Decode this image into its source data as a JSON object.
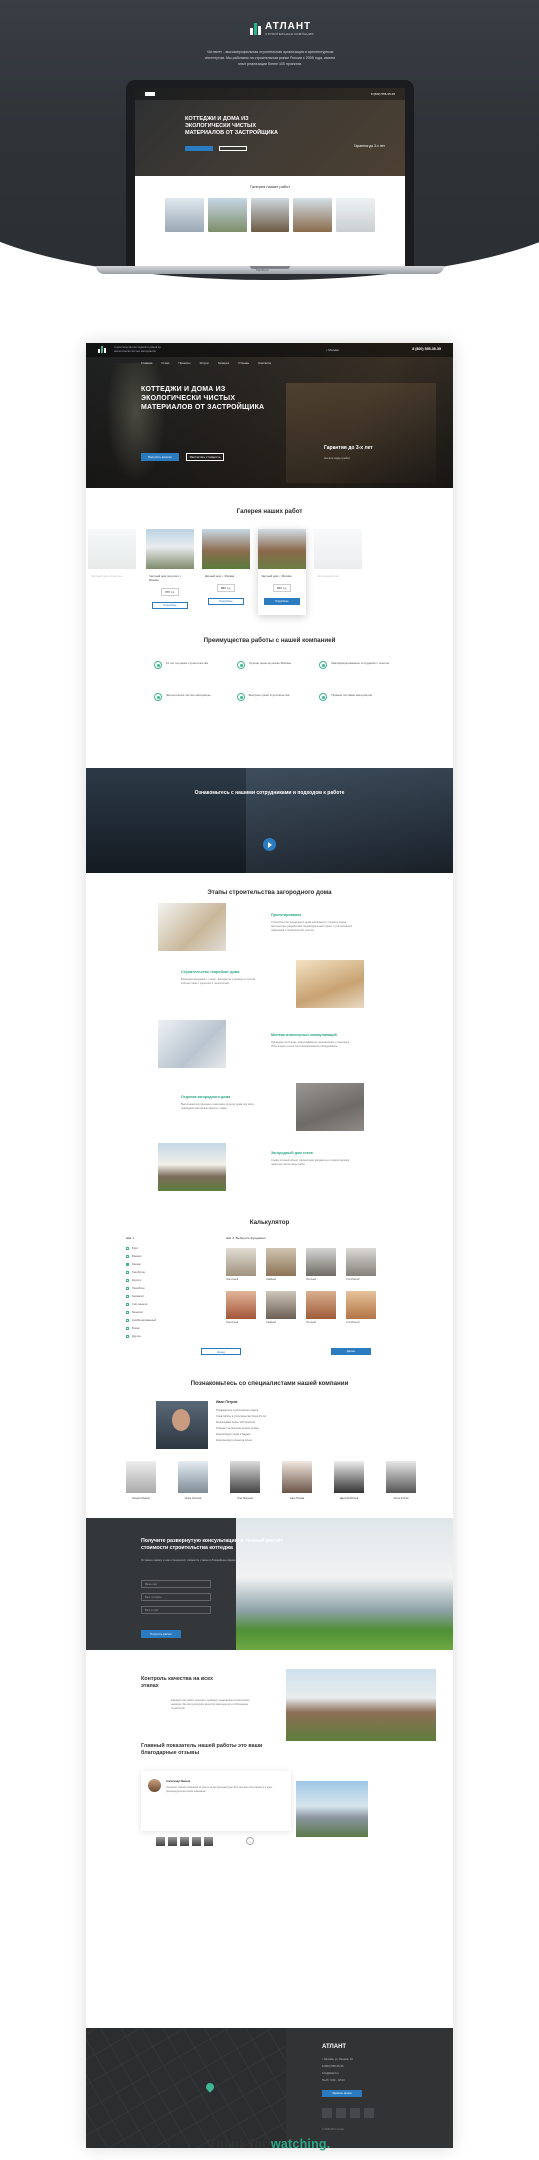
{
  "colors": {
    "accent": "#2aa783",
    "primary_button": "#2a7bc0",
    "dark": "#313335"
  },
  "hero": {
    "brand": "АТЛАНТ",
    "brand_sub": "СТРОИТЕЛЬНАЯ КОМПАНИЯ",
    "intro": "«Атлант» - высокопрофильная строительная организация в архитектурным институтом. Мы работаем на строительном рынке России с 2005 года, имеем опыт реализации более 100 проектов.",
    "laptop_label": "MacBook"
  },
  "laptop_screen": {
    "phone": "8 (800) 555-35-35",
    "title": "КОТТЕДЖИ И ДОМА ИЗ ЭКОЛОГИЧЕСКИ ЧИСТЫХ МАТЕРИАЛОВ ОТ ЗАСТРОЙЩИКА",
    "guarantee": "Гарантия до 3-х лет",
    "gallery_title": "Галерея наших работ"
  },
  "site": {
    "topbar": {
      "tagline": "Строительство коттеджей и домов из экологически чистых материалов",
      "city": "г. Москва",
      "phone": "8 (800) 555-35-35"
    },
    "menu": [
      "Главная",
      "О нас",
      "Проекты",
      "Услуги",
      "Галерея",
      "Отзывы",
      "Контакты"
    ],
    "hero": {
      "title": "КОТТЕДЖИ И ДОМА ИЗ ЭКОЛОГИЧЕСКИ ЧИСТЫХ МАТЕРИАЛОВ ОТ ЗАСТРОЙЩИКА",
      "btn_primary": "Получить каталог",
      "btn_secondary": "Рассчитать стоимость",
      "guarantee": "Гарантия до 3-х лет",
      "guarantee_sub": "На все виды работ"
    },
    "gallery": {
      "title": "Галерея наших работ",
      "cards": [
        {
          "title": "Частный дом «Классик»",
          "price": "",
          "button": ""
        },
        {
          "title": "Частный дом под ключ, г. Москва",
          "price": "765 т.р.",
          "button": "Подробнее"
        },
        {
          "title": "Дачный дом, г. Москва",
          "price": "890 т.р.",
          "button": "Подробнее"
        },
        {
          "title": "Частный дом, г. Москва",
          "price": "820 т.р.",
          "button": "Подробнее"
        },
        {
          "title": "Загородный дом",
          "price": "",
          "button": ""
        }
      ]
    },
    "advantages": {
      "title": "Преимущества работы с нашей компанией",
      "items": [
        "10 лет на рынке строительства",
        "Лучшие цены на рынке Москвы",
        "Квалифицированные сотрудники с опытом",
        "Экологически чистые материалы",
        "Быстрые сроки строительства",
        "Прямые поставки материалов"
      ]
    },
    "video": {
      "title": "Ознакомьтесь с нашими сотрудниками и подходом к работе"
    },
    "stages": {
      "title": "Этапы строительства загородного дома",
      "items": [
        {
          "heading": "Проектирование",
          "text": "Строительство загородного дома начинается с проекта. Наши архитекторы разработают индивидуальный проект с учётом ваших пожеланий и особенностей участка."
        },
        {
          "heading": "Строительство «коробки» дома",
          "text": "Возводим фундамент, стены, перекрытия и кровлю в строгом соответствии с проектом и технологией."
        },
        {
          "heading": "Монтаж инженерных коммуникаций",
          "text": "Проводим отопление, водоснабжение, канализацию и электрику. Используем только сертифицированное оборудование."
        },
        {
          "heading": "Отделка загородного дома",
          "text": "Выполняем внутреннюю и внешнюю отделку дома под ключ, подбираем материалы вместе с вами."
        },
        {
          "heading": "Загородный дом готов",
          "text": "Сдаём готовый объект, оформляем документы и предоставляем гарантию на все виды работ."
        }
      ]
    },
    "calculator": {
      "title": "Калькулятор",
      "step1": "Шаг 1",
      "step2": "Шаг 2. Выберите фундамент",
      "options": [
        "Брус",
        "Бревно",
        "Каркас",
        "Газобетон",
        "Кирпич",
        "Пеноблок",
        "Керамзит",
        "Сип-панели",
        "Монолит",
        "Комбинированный",
        "Блоки",
        "Другое"
      ],
      "swatches": [
        "Ленточный",
        "Свайный",
        "Плитный",
        "Столбчатый",
        "Ленточный",
        "Свайный",
        "Плитный",
        "Столбчатый"
      ],
      "btn_back": "Назад",
      "btn_next": "Далее"
    },
    "team": {
      "title": "Познакомьтесь со специалистами нашей компании",
      "lead_name": "Иван Петров",
      "lead_lines": [
        "Руководитель строительного отдела",
        "Стаж работы в строительстве более 15 лет",
        "Реализовано более 120 проектов",
        "Отвечает за качество на всех этапах",
        "Контролирует сроки и бюджет",
        "Консультирует клиентов лично"
      ],
      "members": [
        "Михаил Иванов",
        "Игорь Соколов",
        "Олег Морозов",
        "Анна Попова",
        "Дмитрий Волков",
        "Антон Козлов"
      ]
    },
    "cta": {
      "title": "Получите развернутую консультацию и точный расчёт стоимости строительства коттеджа",
      "subtitle": "Оставьте заявку и наш специалист свяжется с вами в ближайшее время",
      "fields": [
        "Ваше имя",
        "Ваш телефон",
        "Ваш e-mail"
      ],
      "button": "Получить расчёт"
    },
    "quality": {
      "title": "Контроль качества на всех этапах",
      "text": "Каждый этап работ проходит проверку инженерами технического надзора. Мы контролируем качество материалов и соблюдение технологий."
    },
    "reviews": {
      "title": "Главный показатель нашей работы это ваши благодарные отзывы",
      "name": "Александр Иванов",
      "text": "Огромное спасибо компании «Атлант» за построенный дом. Всё сделано качественно и в срок, рекомендую всем своим знакомым!"
    },
    "footer": {
      "brand": "АТЛАНТ",
      "contacts": [
        "г. Москва, ул. Ленина, 10",
        "8 (800) 555-35-35",
        "info@atlant.ru",
        "Пн-Пт 9:00 - 18:00"
      ],
      "button": "Заказать звонок",
      "copyright": "© 2005-2017 Атлант"
    }
  },
  "thanks": {
    "text": "Thank for ",
    "accent": "watching."
  }
}
